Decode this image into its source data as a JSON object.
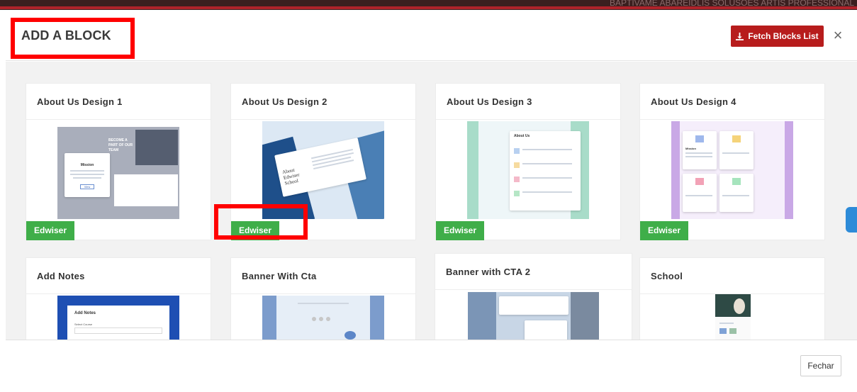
{
  "header": {
    "title": "ADD A BLOCK",
    "fetch_label": "Fetch Blocks List",
    "close_glyph": "×",
    "background_text": "BAPTIVAME ABAREIDLIS SOLUSOES ARTIS PROFESSIONAL"
  },
  "blocks": [
    {
      "title": "About Us Design 1",
      "badge": "Edwiser",
      "thumb_title": "BECOME A PART OF OUR TEAM",
      "thumb_card": "Mission",
      "thumb_button": "View"
    },
    {
      "title": "About Us Design 2",
      "badge": "Edwiser",
      "thumb_title": "About Edwiser School"
    },
    {
      "title": "About Us Design 3",
      "badge": "Edwiser",
      "thumb_title": "About Us"
    },
    {
      "title": "About Us Design 4",
      "badge": "Edwiser",
      "thumb_card": "Mission"
    },
    {
      "title": "Add Notes",
      "thumb_title": "Add Notes",
      "thumb_field": "Select Course"
    },
    {
      "title": "Banner With Cta"
    },
    {
      "title": "Banner with CTA 2"
    },
    {
      "title": "School"
    }
  ],
  "footer": {
    "close_label": "Fechar"
  },
  "colors": {
    "fetch_button": "#b71c1c",
    "badge": "#3fae49",
    "highlight": "#ff0000"
  },
  "icons": [
    "download-icon",
    "close-icon"
  ]
}
